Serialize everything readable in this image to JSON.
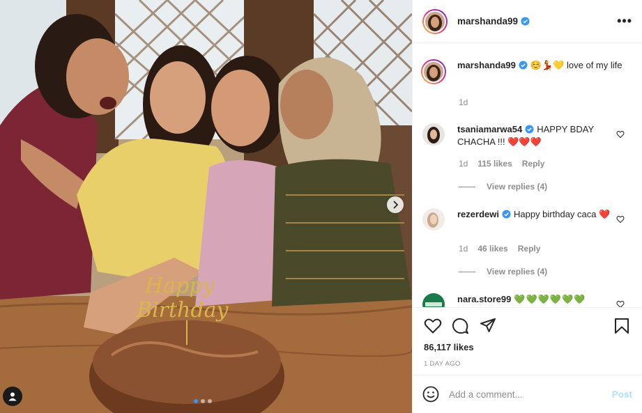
{
  "post": {
    "author": "marshanda99",
    "caption_text": "☺️💃💛 love of my life",
    "caption_age": "1d",
    "likes": "86,117 likes",
    "date": "1 DAY AGO",
    "carousel": {
      "slides": 3,
      "active": 1
    }
  },
  "header": {
    "username": "marshanda99",
    "more_label": "•••"
  },
  "comments": [
    {
      "user": "tsaniamarwa54",
      "text": "HAPPY BDAY CHACHA !!! ❤️❤️❤️",
      "age": "1d",
      "likes": "115 likes",
      "reply": "Reply",
      "view_replies": "View replies (4)"
    },
    {
      "user": "rezerdewi",
      "text": "Happy birthday caca ❤️",
      "age": "1d",
      "likes": "46 likes",
      "reply": "Reply",
      "view_replies": "View replies (4)"
    },
    {
      "user": "nara.store99",
      "text": "💚💚💚💚💚💚"
    }
  ],
  "add_comment": {
    "placeholder": "Add a comment...",
    "post_label": "Post"
  },
  "icons": [
    "verified-badge-icon",
    "heart-icon",
    "comment-icon",
    "share-icon",
    "bookmark-icon",
    "emoji-icon",
    "chevron-right-icon",
    "user-tag-icon",
    "more-options-icon"
  ],
  "colors": {
    "verified": "#3897f0",
    "heart_red": "#ed4956",
    "green_heart": "#1dbb1d",
    "muted": "#8e8e8e",
    "post_button": "#b2dffc"
  }
}
